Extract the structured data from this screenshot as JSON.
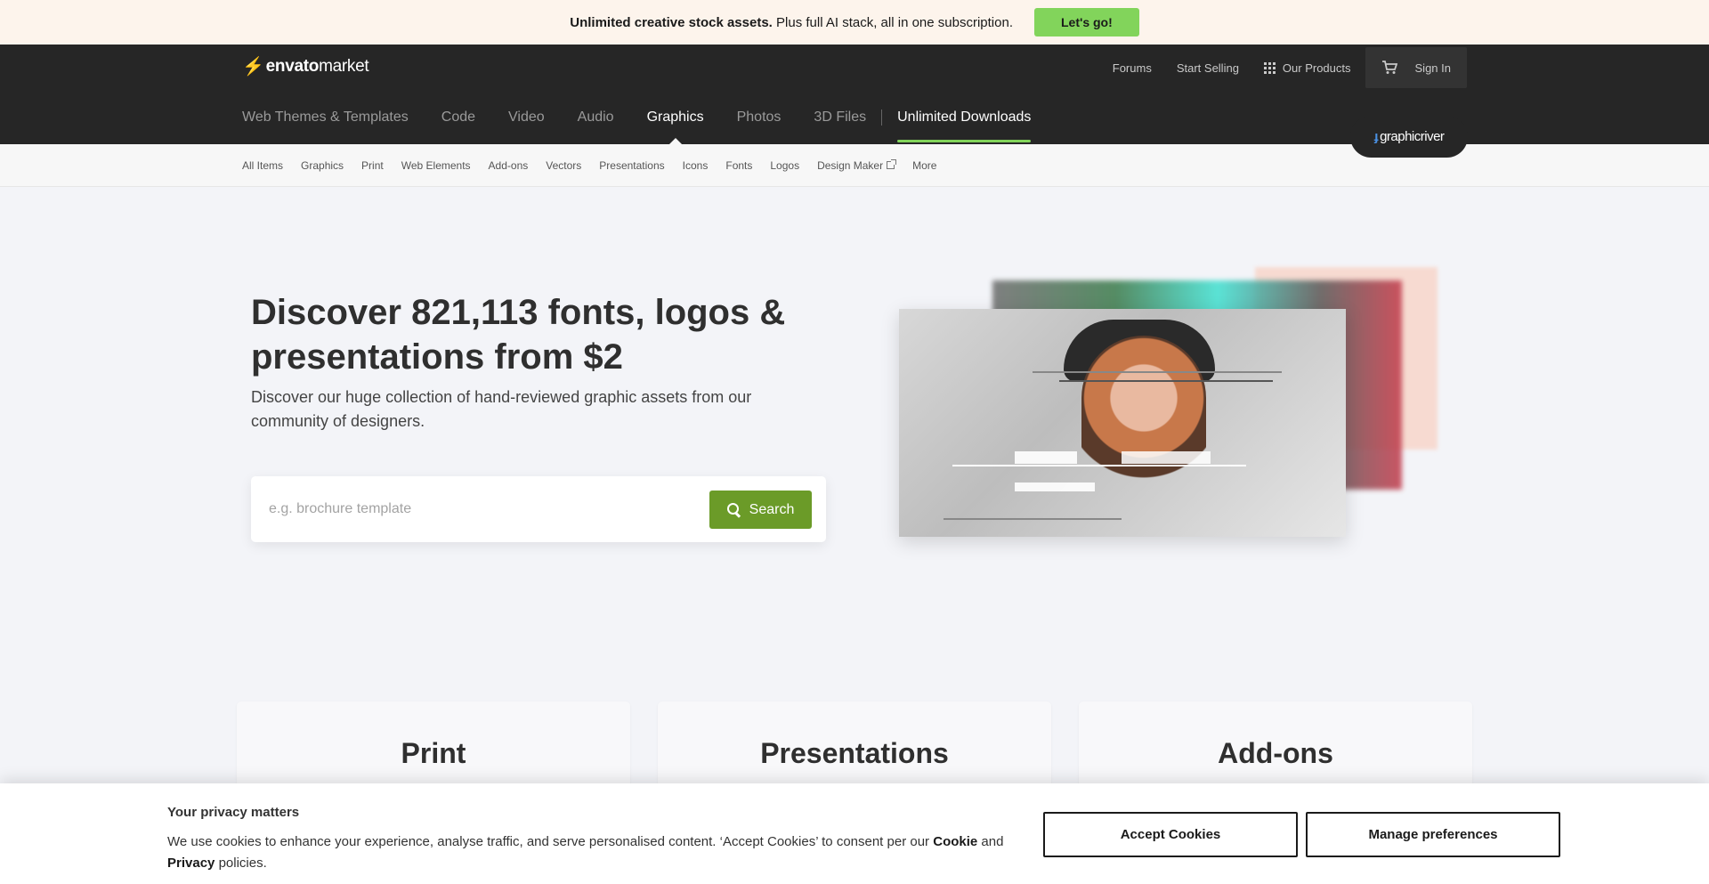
{
  "promo": {
    "bold": "Unlimited creative stock assets.",
    "text": "Plus full AI stack, all in one subscription.",
    "cta": "Let's go!"
  },
  "header": {
    "logo_leaf": "e",
    "logo_bold": "nvato",
    "logo_rest": "market",
    "top_links": {
      "forums": "Forums",
      "start_selling": "Start Selling",
      "our_products": "Our Products",
      "sign_in": "Sign In"
    },
    "main_nav": [
      "Web Themes & Templates",
      "Code",
      "Video",
      "Audio",
      "Graphics",
      "Photos",
      "3D Files"
    ],
    "unlimited": "Unlimited Downloads",
    "badge_text": "graphicriver"
  },
  "sub_nav": [
    "All Items",
    "Graphics",
    "Print",
    "Web Elements",
    "Add-ons",
    "Vectors",
    "Presentations",
    "Icons",
    "Fonts",
    "Logos",
    "Design Maker",
    "More"
  ],
  "hero": {
    "title": "Discover 821,113 fonts, logos & presentations from $2",
    "lead": "Discover our huge collection of hand-reviewed graphic assets from our community of designers.",
    "search_placeholder": "e.g. brochure template",
    "search_button": "Search"
  },
  "cards": [
    "Print",
    "Presentations",
    "Add-ons"
  ],
  "cookie": {
    "title": "Your privacy matters",
    "text_before": "We use cookies to enhance your experience, analyse traffic, and serve personalised content. ‘Accept Cookies’ to consent per our",
    "cookie_link": "Cookie",
    "and": "and",
    "privacy_link": "Privacy",
    "text_after": "policies.",
    "accept": "Accept Cookies",
    "manage": "Manage preferences"
  },
  "colors": {
    "accent_green": "#82d45b",
    "search_green": "#6b9b28",
    "header_bg": "#262626",
    "promo_bg": "#fdf4ec"
  }
}
